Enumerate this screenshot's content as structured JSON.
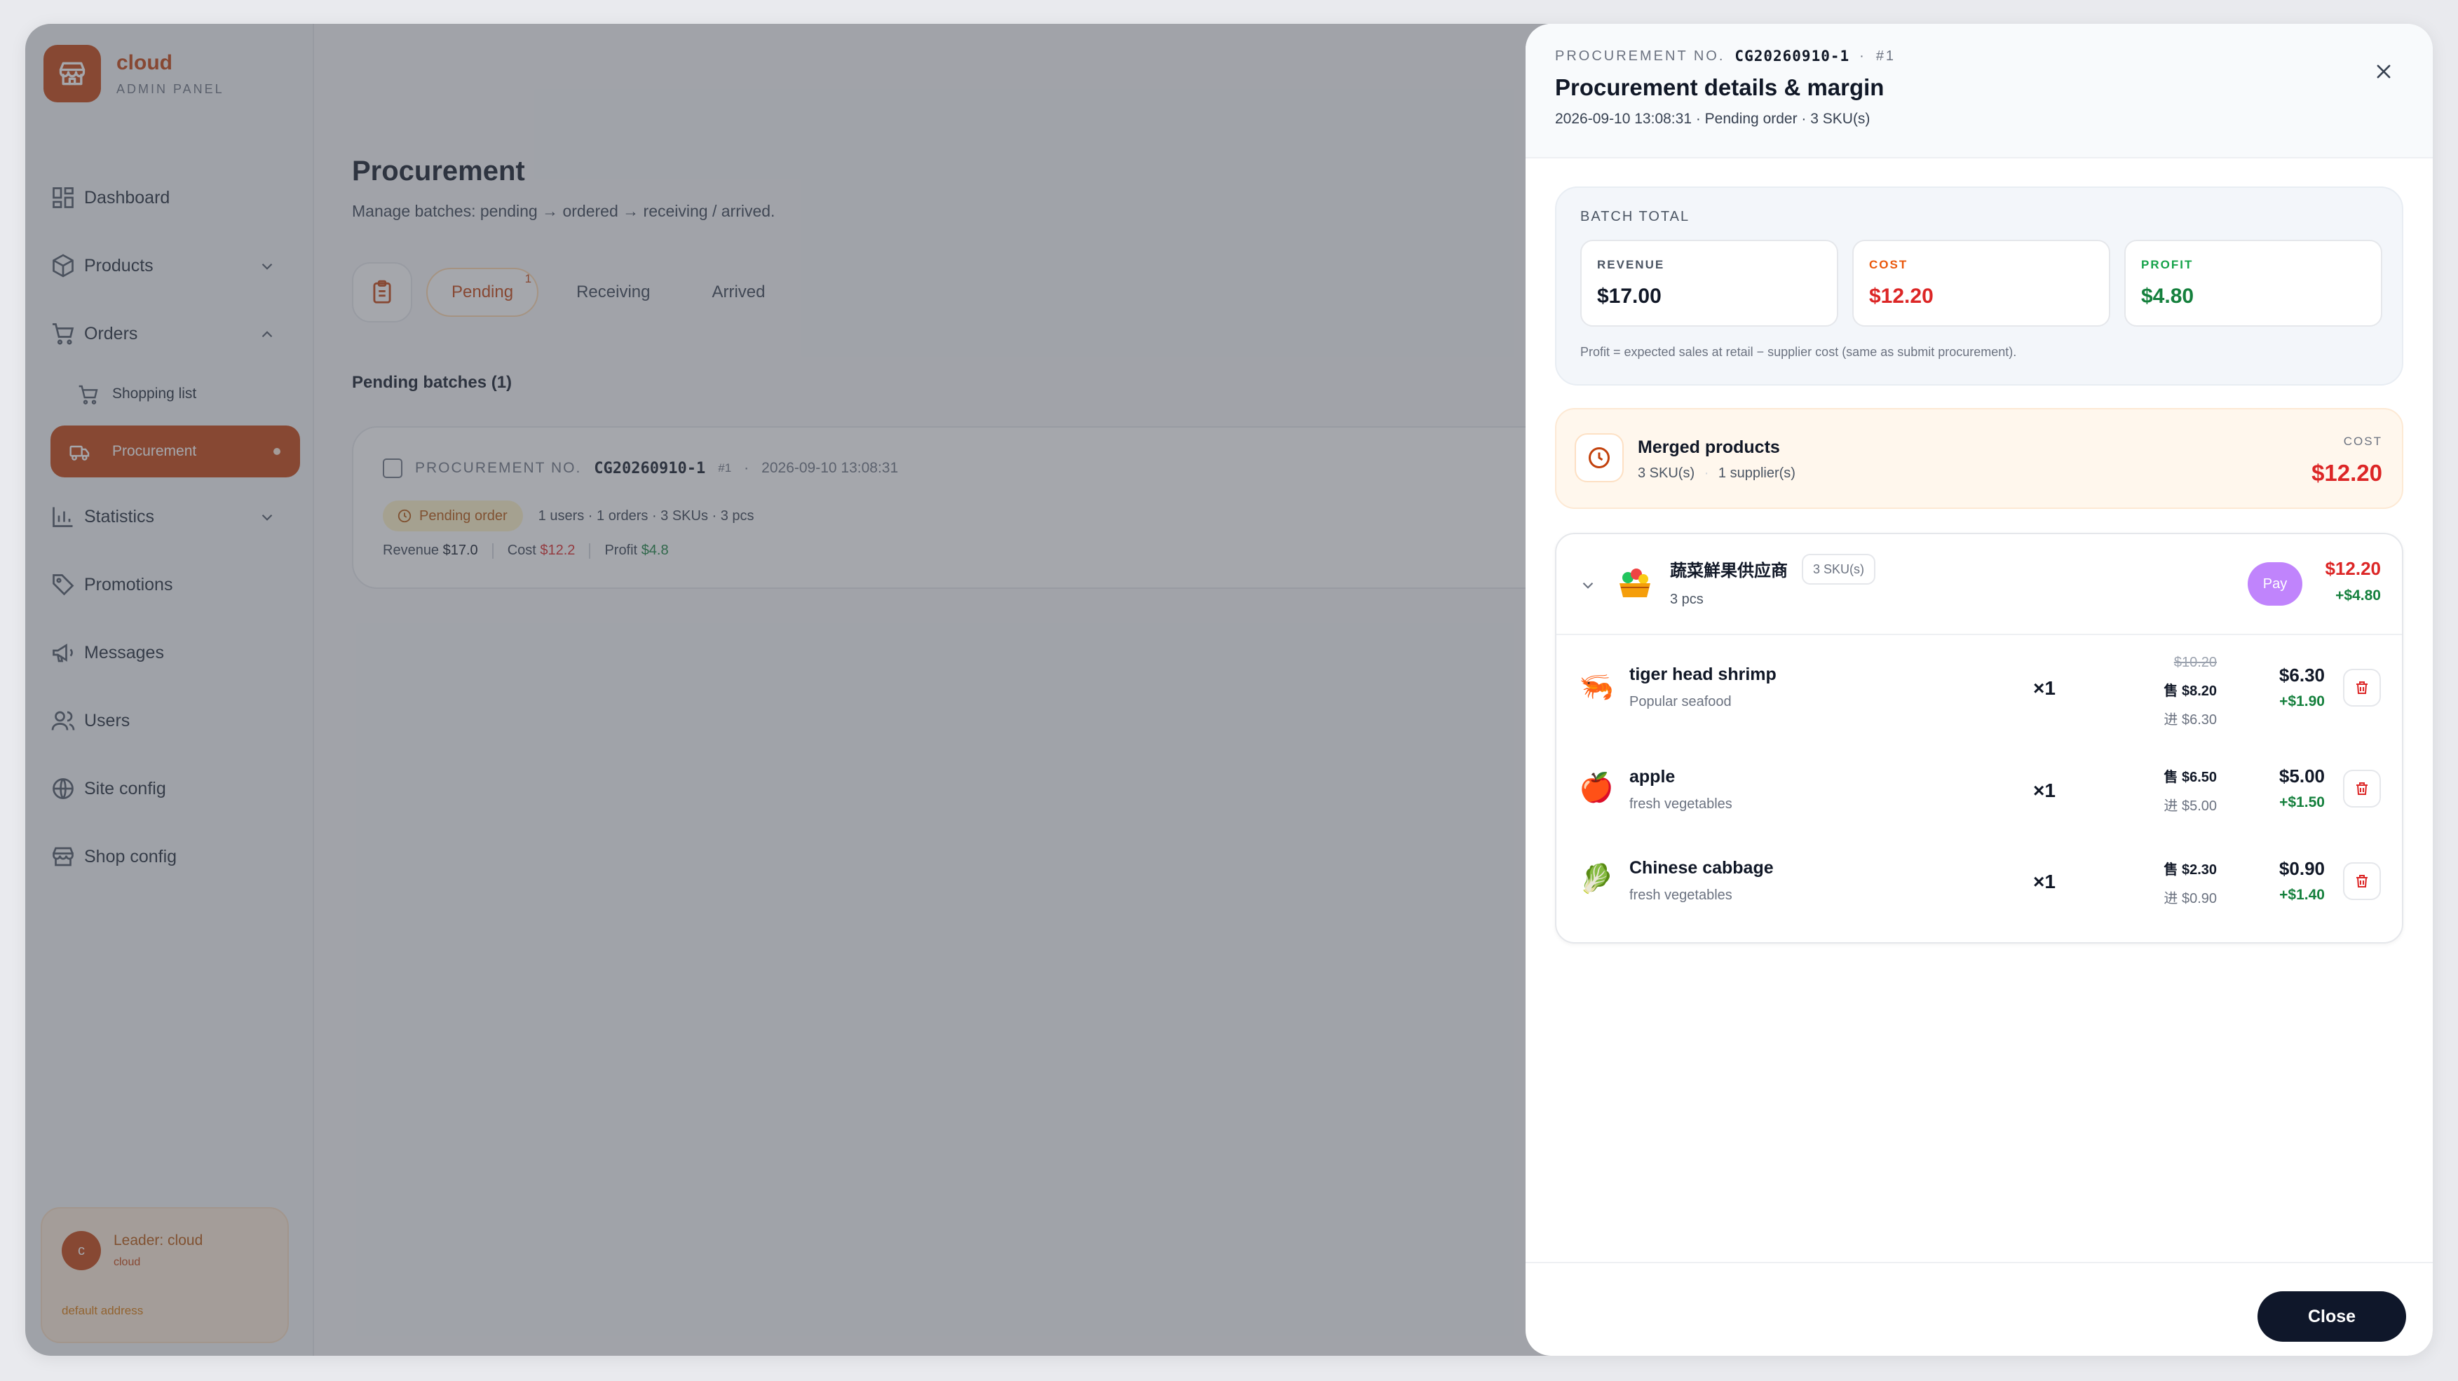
{
  "brand": {
    "name": "cloud",
    "subtitle": "ADMIN PANEL"
  },
  "sidebar": {
    "items": [
      {
        "label": "Dashboard",
        "icon": "dashboard-icon"
      },
      {
        "label": "Products",
        "icon": "box-icon"
      },
      {
        "label": "Orders",
        "icon": "cart-icon"
      },
      {
        "label": "Shopping list",
        "icon": "cart-icon"
      },
      {
        "label": "Procurement",
        "icon": "truck-icon",
        "active": true
      },
      {
        "label": "Statistics",
        "icon": "bar-chart-icon"
      },
      {
        "label": "Promotions",
        "icon": "tag-icon"
      },
      {
        "label": "Messages",
        "icon": "megaphone-icon"
      },
      {
        "label": "Users",
        "icon": "users-icon"
      },
      {
        "label": "Site config",
        "icon": "globe-icon"
      },
      {
        "label": "Shop config",
        "icon": "store-icon"
      }
    ],
    "leader": {
      "avatar": "c",
      "name": "Leader: cloud",
      "role": "cloud",
      "address": "default address"
    }
  },
  "main": {
    "title": "Procurement",
    "subtitle": "Manage batches: pending → ordered → receiving / arrived.",
    "tabs": [
      {
        "label": "Pending",
        "badge": "1",
        "active": true
      },
      {
        "label": "Receiving"
      },
      {
        "label": "Arrived"
      }
    ],
    "section_label": "Pending batches (1)",
    "batch": {
      "label": "PROCUREMENT NO.",
      "number": "CG20260910-1",
      "seq": "#1",
      "dot": "·",
      "time": "2026-09-10 13:08:31",
      "status": "Pending order",
      "stats": "1 users · 1 orders · 3 SKUs · 3 pcs",
      "revenue_label": "Revenue",
      "revenue": "$17.0",
      "cost_label": "Cost",
      "cost": "$12.2",
      "profit_label": "Profit",
      "profit": "$4.8"
    }
  },
  "drawer": {
    "kicker": "PROCUREMENT NO.",
    "number": "CG20260910-1",
    "dot": "·",
    "seq": "#1",
    "title": "Procurement details & margin",
    "meta": "2026-09-10 13:08:31 · Pending order · 3 SKU(s)",
    "batch_total": {
      "label": "BATCH TOTAL",
      "revenue_label": "REVENUE",
      "revenue": "$17.00",
      "cost_label": "COST",
      "cost": "$12.20",
      "profit_label": "PROFIT",
      "profit": "$4.80",
      "note": "Profit = expected sales at retail − supplier cost (same as submit procurement)."
    },
    "merged": {
      "title": "Merged products",
      "skus": "3 SKU(s)",
      "suppliers": "1 supplier(s)",
      "cost_label": "COST",
      "cost": "$12.20"
    },
    "supplier": {
      "name": "蔬菜鮮果供应商",
      "sku_badge": "3 SKU(s)",
      "pcs": "3 pcs",
      "pay_label": "Pay",
      "cost": "$12.20",
      "profit": "+$4.80",
      "items": [
        {
          "emoji": "🦐",
          "name": "tiger head shrimp",
          "category": "Popular seafood",
          "qty": "×1",
          "old_price": "$10.20",
          "sell": "售 $8.20",
          "buy": "进 $6.30",
          "cost": "$6.30",
          "profit": "+$1.90"
        },
        {
          "emoji": "🍎",
          "name": "apple",
          "category": "fresh vegetables",
          "qty": "×1",
          "sell": "售 $6.50",
          "buy": "进 $5.00",
          "cost": "$5.00",
          "profit": "+$1.50"
        },
        {
          "emoji": "🥬",
          "name": "Chinese cabbage",
          "category": "fresh vegetables",
          "qty": "×1",
          "sell": "售 $2.30",
          "buy": "进 $0.90",
          "cost": "$0.90",
          "profit": "+$1.40"
        }
      ]
    },
    "close_label": "Close"
  },
  "colors": {
    "accent": "#c2410c",
    "cost": "#dc2626",
    "profit": "#15803d",
    "pay": "#c084fc"
  }
}
